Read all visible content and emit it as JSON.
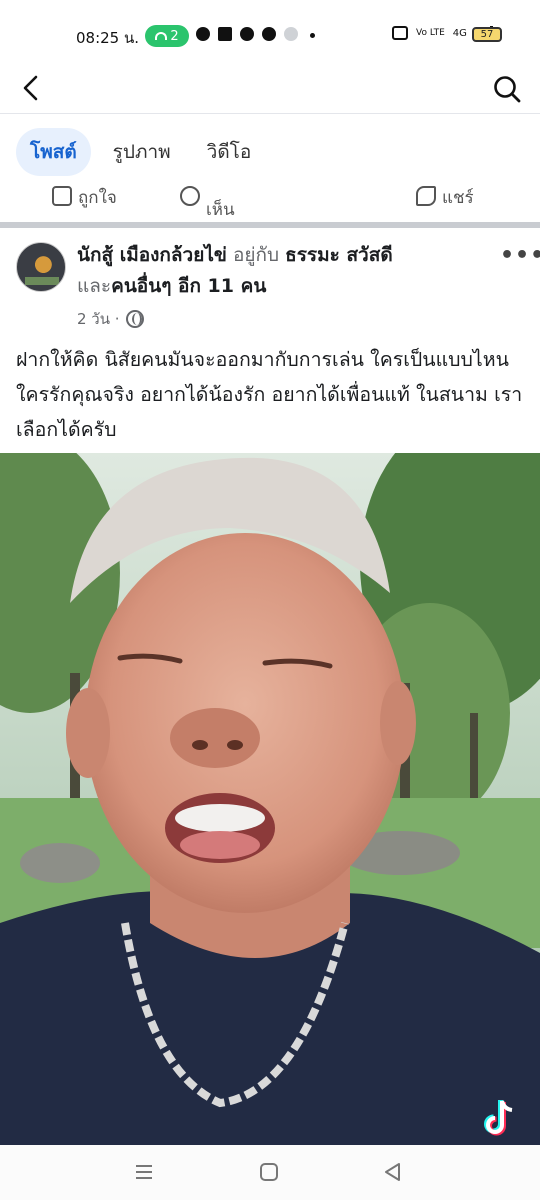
{
  "status_bar": {
    "time": "08:25 น.",
    "pill_count": "2",
    "network": "4G",
    "battery": "57"
  },
  "header": {
    "back_icon": "back-arrow-icon",
    "search_icon": "search-icon"
  },
  "tabs": [
    {
      "label": "โพสต์",
      "active": true
    },
    {
      "label": "รูปภาพ",
      "active": false
    },
    {
      "label": "วิดีโอ",
      "active": false
    }
  ],
  "reactions": {
    "like": "ถูกใจ",
    "comment": "เห็น",
    "share": "แชร์"
  },
  "post": {
    "author": "นักสู้ เมืองกล้วยไข่",
    "with_text": "อยู่กับ",
    "tagged": "ธรรมะ สวัสดี",
    "and_text": "และ",
    "others": "คนอื่นๆ อีก 11 คน",
    "time": "2 วัน ·",
    "body": "ฝากให้คิด  นิสัยคนมันจะออกมากับการเล่น  ใครเป็นแบบไหนใครรักคุณจริง   อยากได้น้องรัก  อยากได้เพื่อนแท้   ในสนาม  เราเลือกได้ครับ",
    "more_label": "•••"
  },
  "colors": {
    "accent": "#1763cf",
    "tab_active_bg": "#e7f0fd",
    "muted": "#65676b"
  }
}
